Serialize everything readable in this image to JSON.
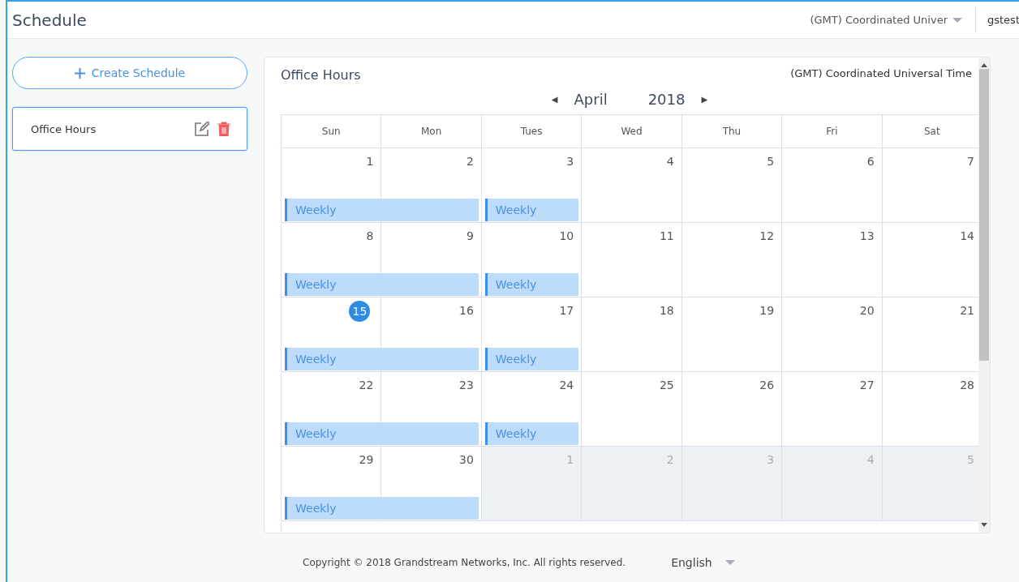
{
  "header": {
    "title": "Schedule",
    "timezone": "(GMT) Coordinated Univer",
    "user": "gstest"
  },
  "sidebar": {
    "create_button": "Create Schedule",
    "items": [
      {
        "label": "Office Hours",
        "selected": true
      }
    ]
  },
  "calendar": {
    "title": "Office Hours",
    "timezone": "(GMT) Coordinated Universal Time",
    "month": "April",
    "year": "2018",
    "prev": "◀",
    "next": "▶",
    "weekdays": [
      "Sun",
      "Mon",
      "Tues",
      "Wed",
      "Thu",
      "Fri",
      "Sat"
    ],
    "weeks": [
      {
        "days": [
          {
            "label": "1",
            "other_month": false,
            "today": false,
            "event": {
              "label": "Weekly",
              "continues_next_day": true
            }
          },
          {
            "label": "2",
            "other_month": false,
            "today": false
          },
          {
            "label": "3",
            "other_month": false,
            "today": false,
            "event": {
              "label": "Weekly",
              "continues_next_day": false
            }
          },
          {
            "label": "4",
            "other_month": false,
            "today": false
          },
          {
            "label": "5",
            "other_month": false,
            "today": false
          },
          {
            "label": "6",
            "other_month": false,
            "today": false
          },
          {
            "label": "7",
            "other_month": false,
            "today": false
          }
        ]
      },
      {
        "days": [
          {
            "label": "8",
            "other_month": false,
            "today": false,
            "event": {
              "label": "Weekly",
              "continues_next_day": true
            }
          },
          {
            "label": "9",
            "other_month": false,
            "today": false
          },
          {
            "label": "10",
            "other_month": false,
            "today": false,
            "event": {
              "label": "Weekly",
              "continues_next_day": false
            }
          },
          {
            "label": "11",
            "other_month": false,
            "today": false
          },
          {
            "label": "12",
            "other_month": false,
            "today": false
          },
          {
            "label": "13",
            "other_month": false,
            "today": false
          },
          {
            "label": "14",
            "other_month": false,
            "today": false
          }
        ]
      },
      {
        "days": [
          {
            "label": "15",
            "other_month": false,
            "today": true,
            "event": {
              "label": "Weekly",
              "continues_next_day": true
            }
          },
          {
            "label": "16",
            "other_month": false,
            "today": false
          },
          {
            "label": "17",
            "other_month": false,
            "today": false,
            "event": {
              "label": "Weekly",
              "continues_next_day": false
            }
          },
          {
            "label": "18",
            "other_month": false,
            "today": false
          },
          {
            "label": "19",
            "other_month": false,
            "today": false
          },
          {
            "label": "20",
            "other_month": false,
            "today": false
          },
          {
            "label": "21",
            "other_month": false,
            "today": false
          }
        ]
      },
      {
        "days": [
          {
            "label": "22",
            "other_month": false,
            "today": false,
            "event": {
              "label": "Weekly",
              "continues_next_day": true
            }
          },
          {
            "label": "23",
            "other_month": false,
            "today": false
          },
          {
            "label": "24",
            "other_month": false,
            "today": false,
            "event": {
              "label": "Weekly",
              "continues_next_day": false
            }
          },
          {
            "label": "25",
            "other_month": false,
            "today": false
          },
          {
            "label": "26",
            "other_month": false,
            "today": false
          },
          {
            "label": "27",
            "other_month": false,
            "today": false
          },
          {
            "label": "28",
            "other_month": false,
            "today": false
          }
        ]
      },
      {
        "days": [
          {
            "label": "29",
            "other_month": false,
            "today": false,
            "event": {
              "label": "Weekly",
              "continues_next_day": true
            }
          },
          {
            "label": "30",
            "other_month": false,
            "today": false
          },
          {
            "label": "1",
            "other_month": true,
            "today": false
          },
          {
            "label": "2",
            "other_month": true,
            "today": false
          },
          {
            "label": "3",
            "other_month": true,
            "today": false
          },
          {
            "label": "4",
            "other_month": true,
            "today": false
          },
          {
            "label": "5",
            "other_month": true,
            "today": false
          }
        ]
      }
    ]
  },
  "footer": {
    "copyright": "Copyright © 2018 Grandstream Networks, Inc. All rights reserved.",
    "language": "English"
  }
}
